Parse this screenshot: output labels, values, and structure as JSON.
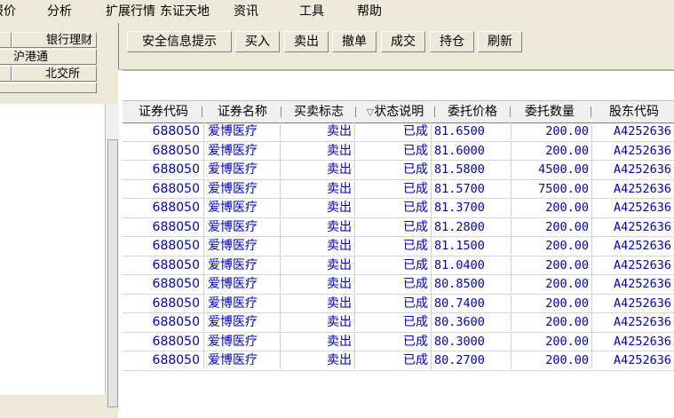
{
  "menu": {
    "items": [
      "报价",
      "分析",
      "扩展行情",
      "东证天地",
      "资讯",
      "工具",
      "帮助"
    ]
  },
  "left_panel": {
    "buttons": [
      "银行理财",
      "沪港通",
      "北交所"
    ]
  },
  "toolbar": {
    "buttons": [
      "安全信息提示",
      "买入",
      "卖出",
      "撤单",
      "成交",
      "持仓",
      "刷新"
    ]
  },
  "table": {
    "columns": [
      "证券代码",
      "证券名称",
      "买卖标志",
      "状态说明",
      "委托价格",
      "委托数量",
      "股东代码"
    ],
    "sorted_column_icon": "filter-triangle-icon",
    "rows": [
      {
        "code": "688050",
        "name": "爱博医疗",
        "side": "卖出",
        "status": "已成",
        "price": "81.6500",
        "qty": "200.00",
        "holder": "A4252636"
      },
      {
        "code": "688050",
        "name": "爱博医疗",
        "side": "卖出",
        "status": "已成",
        "price": "81.6000",
        "qty": "200.00",
        "holder": "A4252636"
      },
      {
        "code": "688050",
        "name": "爱博医疗",
        "side": "卖出",
        "status": "已成",
        "price": "81.5800",
        "qty": "4500.00",
        "holder": "A4252636"
      },
      {
        "code": "688050",
        "name": "爱博医疗",
        "side": "卖出",
        "status": "已成",
        "price": "81.5700",
        "qty": "7500.00",
        "holder": "A4252636"
      },
      {
        "code": "688050",
        "name": "爱博医疗",
        "side": "卖出",
        "status": "已成",
        "price": "81.3700",
        "qty": "200.00",
        "holder": "A4252636"
      },
      {
        "code": "688050",
        "name": "爱博医疗",
        "side": "卖出",
        "status": "已成",
        "price": "81.2800",
        "qty": "200.00",
        "holder": "A4252636"
      },
      {
        "code": "688050",
        "name": "爱博医疗",
        "side": "卖出",
        "status": "已成",
        "price": "81.1500",
        "qty": "200.00",
        "holder": "A4252636"
      },
      {
        "code": "688050",
        "name": "爱博医疗",
        "side": "卖出",
        "status": "已成",
        "price": "81.0400",
        "qty": "200.00",
        "holder": "A4252636"
      },
      {
        "code": "688050",
        "name": "爱博医疗",
        "side": "卖出",
        "status": "已成",
        "price": "80.8500",
        "qty": "200.00",
        "holder": "A4252636"
      },
      {
        "code": "688050",
        "name": "爱博医疗",
        "side": "卖出",
        "status": "已成",
        "price": "80.7400",
        "qty": "200.00",
        "holder": "A4252636"
      },
      {
        "code": "688050",
        "name": "爱博医疗",
        "side": "卖出",
        "status": "已成",
        "price": "80.3600",
        "qty": "200.00",
        "holder": "A4252636"
      },
      {
        "code": "688050",
        "name": "爱博医疗",
        "side": "卖出",
        "status": "已成",
        "price": "80.3000",
        "qty": "200.00",
        "holder": "A4252636"
      },
      {
        "code": "688050",
        "name": "爱博医疗",
        "side": "卖出",
        "status": "已成",
        "price": "80.2700",
        "qty": "200.00",
        "holder": "A4252636"
      }
    ]
  },
  "colors": {
    "row_text": "#0000c8",
    "chrome": "#ece9d8"
  }
}
